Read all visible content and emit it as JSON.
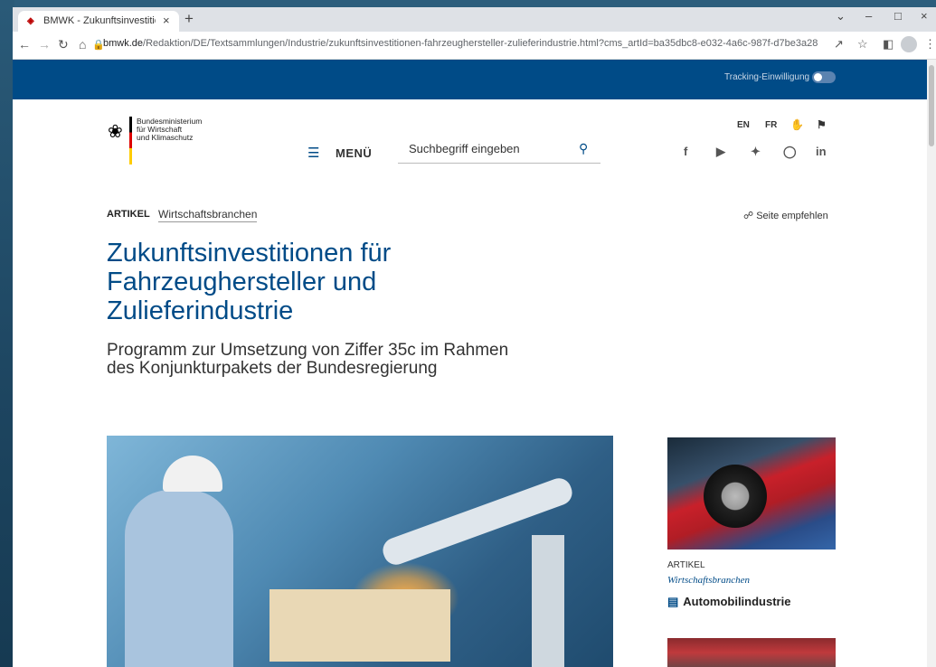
{
  "browser": {
    "tab_title": "BMWK - Zukunftsinvestitionen fü",
    "url_domain": "bmwk.de",
    "url_path": "/Redaktion/DE/Textsammlungen/Industrie/zukunftsinvestitionen-fahrzeughersteller-zulieferindustrie.html?cms_artId=ba35dbc8-e032-4a6c-987f-d7be3a284b7a"
  },
  "header": {
    "tracking_label": "Tracking-Einwilligung",
    "tracking_on": false,
    "logo_text": [
      "Bundesministerium",
      "für Wirtschaft",
      "und Klimaschutz"
    ],
    "lang_en": "EN",
    "lang_fr": "FR",
    "menu_label": "MENÜ",
    "search_placeholder": "Suchbegriff eingeben"
  },
  "article": {
    "type": "ARTIKEL",
    "category": "Wirtschaftsbranchen",
    "share_label": "Seite empfehlen",
    "title": "Zukunftsinvestitionen für Fahrzeughersteller und Zulieferindustrie",
    "subtitle": "Programm zur Umsetzung von Ziffer 35c im Rahmen des Konjunkturpakets der Bundesregierung"
  },
  "sidebar_card": {
    "type": "ARTIKEL",
    "category": "Wirtschaftsbranchen",
    "title": "Automobilindustrie"
  }
}
